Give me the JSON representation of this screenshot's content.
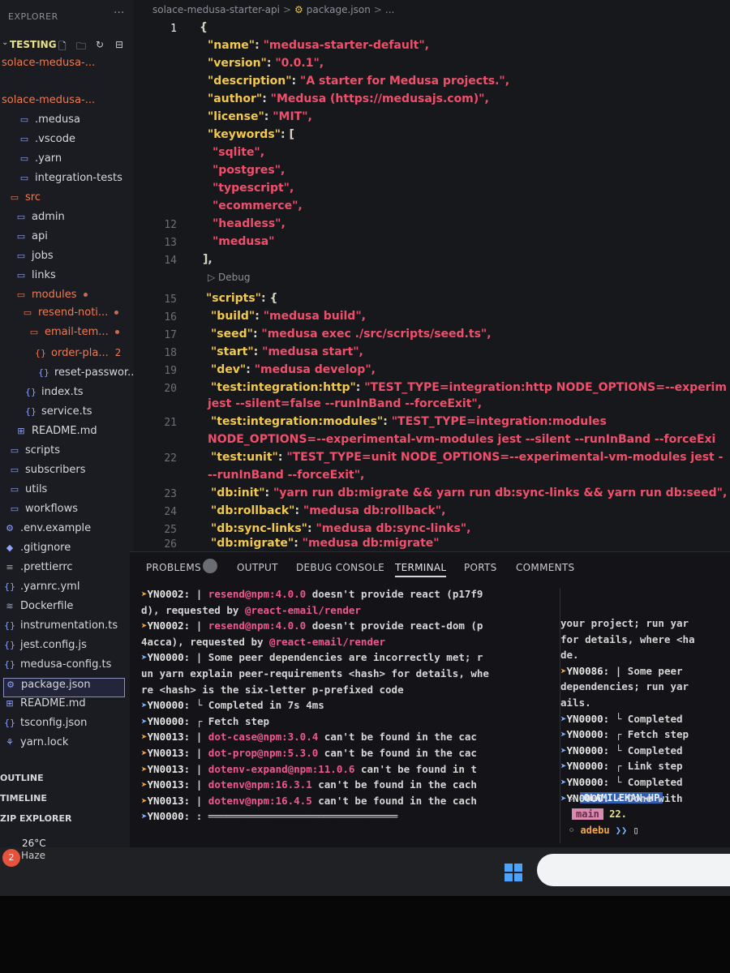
{
  "explorer": {
    "title": "EXPLORER",
    "more": "···",
    "project": "TESTING",
    "items": [
      {
        "label": "solace-medusa-...",
        "icon": "",
        "color": "orange"
      },
      {
        "label": "solace-medusa-...",
        "icon": "",
        "color": "orange"
      },
      {
        "label": ".medusa",
        "icon": "folder-icon"
      },
      {
        "label": ".vscode",
        "icon": "folder-icon"
      },
      {
        "label": ".yarn",
        "icon": "folder-icon"
      },
      {
        "label": "integration-tests",
        "icon": "folder-icon"
      },
      {
        "label": "src",
        "icon": "folder-icon",
        "color": "orange"
      },
      {
        "label": "admin",
        "icon": "folder-icon"
      },
      {
        "label": "api",
        "icon": "folder-icon"
      },
      {
        "label": "jobs",
        "icon": "folder-icon"
      },
      {
        "label": "links",
        "icon": "folder-icon"
      },
      {
        "label": "modules",
        "icon": "folder-icon",
        "color": "orange"
      },
      {
        "label": "resend-noti...",
        "icon": "folder-icon",
        "color": "orange"
      },
      {
        "label": "email-tem...",
        "icon": "folder-icon",
        "color": "orange"
      },
      {
        "label": "order-pla...",
        "icon": "braces-icon",
        "color": "orange",
        "badge": "2"
      },
      {
        "label": "reset-passwor...",
        "icon": "braces-icon"
      },
      {
        "label": "index.ts",
        "icon": "braces-icon"
      },
      {
        "label": "service.ts",
        "icon": "braces-icon"
      },
      {
        "label": "README.md",
        "icon": "book-icon"
      },
      {
        "label": "scripts",
        "icon": "folder-icon"
      },
      {
        "label": "subscribers",
        "icon": "folder-icon"
      },
      {
        "label": "utils",
        "icon": "folder-icon"
      },
      {
        "label": "workflows",
        "icon": "folder-icon"
      },
      {
        "label": ".env.example",
        "icon": "gear-icon"
      },
      {
        "label": ".gitignore",
        "icon": "git-icon"
      },
      {
        "label": ".prettierrc",
        "icon": "prettier-icon"
      },
      {
        "label": ".yarnrc.yml",
        "icon": "braces-icon"
      },
      {
        "label": "Dockerfile",
        "icon": "docker-icon"
      },
      {
        "label": "instrumentation.ts",
        "icon": "braces-icon"
      },
      {
        "label": "jest.config.js",
        "icon": "braces-icon"
      },
      {
        "label": "medusa-config.ts",
        "icon": "braces-icon"
      },
      {
        "label": "package.json",
        "icon": "gear-icon",
        "selected": true
      },
      {
        "label": "README.md",
        "icon": "book-icon"
      },
      {
        "label": "tsconfig.json",
        "icon": "braces-icon"
      },
      {
        "label": "yarn.lock",
        "icon": "yarn-icon"
      }
    ],
    "sections": [
      "OUTLINE",
      "TIMELINE",
      "ZIP EXPLORER"
    ]
  },
  "breadcrumb": {
    "folder": "solace-medusa-starter-api",
    "file": "package.json",
    "rest": "..."
  },
  "editor": {
    "debug_label": "▷ Debug",
    "lines": [
      {
        "n": "1",
        "text": "{",
        "kind": "p"
      },
      {
        "n": "",
        "key": "\"name\"",
        "val": "\"medusa-starter-default\","
      },
      {
        "n": "",
        "key": "\"version\"",
        "val": "\"0.0.1\","
      },
      {
        "n": "",
        "key": "\"description\"",
        "val": "\"A starter for Medusa projects.\","
      },
      {
        "n": "",
        "key": "\"author\"",
        "val": "\"Medusa (https://medusajs.com)\","
      },
      {
        "n": "",
        "key": "\"license\"",
        "val": "\"MIT\","
      },
      {
        "n": "",
        "key": "\"keywords\"",
        "val": "["
      },
      {
        "n": "",
        "str": "\"sqlite\","
      },
      {
        "n": "",
        "str": "\"postgres\","
      },
      {
        "n": "",
        "str": "\"typescript\","
      },
      {
        "n": "",
        "str": "\"ecommerce\","
      },
      {
        "n": "12",
        "str": "\"headless\","
      },
      {
        "n": "13",
        "str": "\"medusa\""
      },
      {
        "n": "14",
        "text": "],",
        "kind": "p"
      },
      {
        "n": "15",
        "key": "\"scripts\"",
        "val": "{"
      },
      {
        "n": "16",
        "key": "\"build\"",
        "val": "\"medusa build\","
      },
      {
        "n": "17",
        "key": "\"seed\"",
        "val": "\"medusa exec ./src/scripts/seed.ts\","
      },
      {
        "n": "18",
        "key": "\"start\"",
        "val": "\"medusa start\","
      },
      {
        "n": "19",
        "key": "\"dev\"",
        "val": "\"medusa develop\","
      },
      {
        "n": "20",
        "key": "\"test:integration:http\"",
        "val": "\"TEST_TYPE=integration:http NODE_OPTIONS=--experim"
      },
      {
        "n": "",
        "cont": "jest --silent=false --runInBand --forceExit\","
      },
      {
        "n": "21",
        "key": "\"test:integration:modules\"",
        "val": "\"TEST_TYPE=integration:modules"
      },
      {
        "n": "",
        "cont": "NODE_OPTIONS=--experimental-vm-modules jest --silent --runInBand --forceExi"
      },
      {
        "n": "22",
        "key": "\"test:unit\"",
        "val": "\"TEST_TYPE=unit NODE_OPTIONS=--experimental-vm-modules jest -"
      },
      {
        "n": "",
        "cont": "--runInBand --forceExit\","
      },
      {
        "n": "23",
        "key": "\"db:init\"",
        "val": "\"yarn run db:migrate && yarn run db:sync-links && yarn run db:seed\","
      },
      {
        "n": "24",
        "key": "\"db:rollback\"",
        "val": "\"medusa db:rollback\","
      },
      {
        "n": "25",
        "key": "\"db:sync-links\"",
        "val": "\"medusa db:sync-links\","
      },
      {
        "n": "26",
        "key": "\"db:migrate\"",
        "val": "\"medusa db:migrate\""
      }
    ]
  },
  "panel": {
    "tabs": [
      "PROBLEMS",
      "OUTPUT",
      "DEBUG CONSOLE",
      "TERMINAL",
      "PORTS",
      "COMMENTS"
    ],
    "active_tab": "TERMINAL",
    "terminal_left": [
      {
        "arrow": "➤",
        "code": "YN0002:",
        "msg": " | ",
        "pkg": "resend@npm:4.0.0",
        "rest": " doesn't provide react (p17f9"
      },
      {
        "arrow": "",
        "code": "",
        "msg": "d), requested by ",
        "pkg": "@react-email/render",
        "rest": ""
      },
      {
        "arrow": "➤",
        "code": "YN0002:",
        "msg": " | ",
        "pkg": "resend@npm:4.0.0",
        "rest": " doesn't provide react-dom (p"
      },
      {
        "arrow": "",
        "code": "",
        "msg": "4acca), requested by ",
        "pkg": "@react-email/render",
        "rest": ""
      },
      {
        "arrow": "➤",
        "code": "YN0000:",
        "msg": " | Some peer dependencies are incorrectly met; r",
        "pkg": "",
        "rest": ""
      },
      {
        "arrow": "",
        "code": "",
        "msg": "un yarn explain peer-requirements <hash> for details, whe",
        "pkg": "",
        "rest": ""
      },
      {
        "arrow": "",
        "code": "",
        "msg": "re <hash> is the six-letter p-prefixed code",
        "pkg": "",
        "rest": ""
      },
      {
        "arrow": "➤",
        "code": "YN0000:",
        "msg": " └ Completed in 7s 4ms",
        "pkg": "",
        "rest": ""
      },
      {
        "arrow": "➤",
        "code": "YN0000:",
        "msg": " ┌ Fetch step",
        "pkg": "",
        "rest": ""
      },
      {
        "arrow": "➤",
        "code": "YN0013:",
        "msg": " | ",
        "pkg": "dot-case@npm:3.0.4",
        "rest": " can't be found in the cac"
      },
      {
        "arrow": "➤",
        "code": "YN0013:",
        "msg": " | ",
        "pkg": "dot-prop@npm:5.3.0",
        "rest": " can't be found in the cac"
      },
      {
        "arrow": "➤",
        "code": "YN0013:",
        "msg": " | ",
        "pkg": "dotenv-expand@npm:11.0.6",
        "rest": " can't be found in t"
      },
      {
        "arrow": "➤",
        "code": "YN0013:",
        "msg": " | ",
        "pkg": "dotenv@npm:16.3.1",
        "rest": " can't be found in the cach"
      },
      {
        "arrow": "➤",
        "code": "YN0013:",
        "msg": " | ",
        "pkg": "dotenv@npm:16.4.5",
        "rest": " can't be found in the cach"
      },
      {
        "arrow": "➤",
        "code": "YN0000:",
        "msg": " : ═══════════════════════════════",
        "pkg": "",
        "rest": ""
      }
    ],
    "terminal_right": [
      {
        "arrow": "",
        "code": "",
        "msg": " your project; run yar"
      },
      {
        "arrow": "",
        "code": "",
        "msg": "for details, where <ha"
      },
      {
        "arrow": "",
        "code": "",
        "msg": "de."
      },
      {
        "arrow": "➤",
        "code": "YN0086:",
        "msg": " | Some peer"
      },
      {
        "arrow": "",
        "code": "",
        "msg": " dependencies; run yar"
      },
      {
        "arrow": "",
        "code": "",
        "msg": "ails."
      },
      {
        "arrow": "➤",
        "code": "YN0000:",
        "msg": " └ Completed"
      },
      {
        "arrow": "➤",
        "code": "YN0000:",
        "msg": " ┌ Fetch step"
      },
      {
        "arrow": "➤",
        "code": "YN0000:",
        "msg": " └ Completed"
      },
      {
        "arrow": "➤",
        "code": "YN0000:",
        "msg": " ┌ Link step"
      },
      {
        "arrow": "➤",
        "code": "YN0000:",
        "msg": " └ Completed"
      },
      {
        "arrow": "➤",
        "code": "YN0000:",
        "msg": " · Done with"
      }
    ],
    "prompt_host": "OLAMILEKAN-HP",
    "prompt_branch": "main",
    "prompt_extra": "22.",
    "prompt_user": "adebu"
  },
  "taskbar": {
    "badge": "2",
    "temperature": "26°C",
    "condition": "Haze"
  }
}
